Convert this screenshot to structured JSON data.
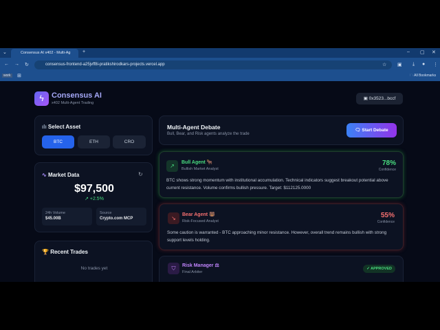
{
  "browser": {
    "tab_title": "Consensus AI x402 - Multi-Ag",
    "url": "consensus-frontend-a25jvff8i-pratikshirodkars-projects.vercel.app",
    "bookmark_work": "work",
    "all_bookmarks": "All Bookmarks"
  },
  "header": {
    "title": "Consensus AI",
    "subtitle": "x402 Multi-Agent Trading",
    "wallet": "0x3523...bccf"
  },
  "select_asset": {
    "title": "Select Asset",
    "assets": [
      "BTC",
      "ETH",
      "CRO"
    ],
    "selected": "BTC"
  },
  "market": {
    "title": "Market Data",
    "price": "$97,500",
    "change": "+2.5%",
    "volume_label": "24h Volume",
    "volume": "$45.00B",
    "source_label": "Source",
    "source": "Crypto.com MCP"
  },
  "trades": {
    "title": "Recent Trades",
    "empty": "No trades yet"
  },
  "debate": {
    "title": "Multi-Agent Debate",
    "subtitle": "Bull, Bear, and Risk agents analyze the trade",
    "start": "Start Debate"
  },
  "agents": [
    {
      "name": "Bull Agent 🐂",
      "role": "Bullish Market Analyst",
      "confidence": "78%",
      "confidence_label": "Confidence",
      "text": "BTC shows strong momentum with institutional accumulation. Technical indicators suggest breakout potential above current resistance. Volume confirms bullish pressure. Target: $112125.0000"
    },
    {
      "name": "Bear Agent 🐻",
      "role": "Risk-Focused Analyst",
      "confidence": "55%",
      "confidence_label": "Confidence",
      "text": "Some caution is warranted - BTC approaching minor resistance. However, overall trend remains bullish with strong support levels holding."
    },
    {
      "name": "Risk Manager ⚖",
      "role": "Final Arbiter",
      "status": "APPROVED"
    }
  ],
  "colors": {
    "bull": "#4ade80",
    "bear": "#f87171",
    "risk": "#c084fc",
    "accent": "#3b82f6"
  }
}
